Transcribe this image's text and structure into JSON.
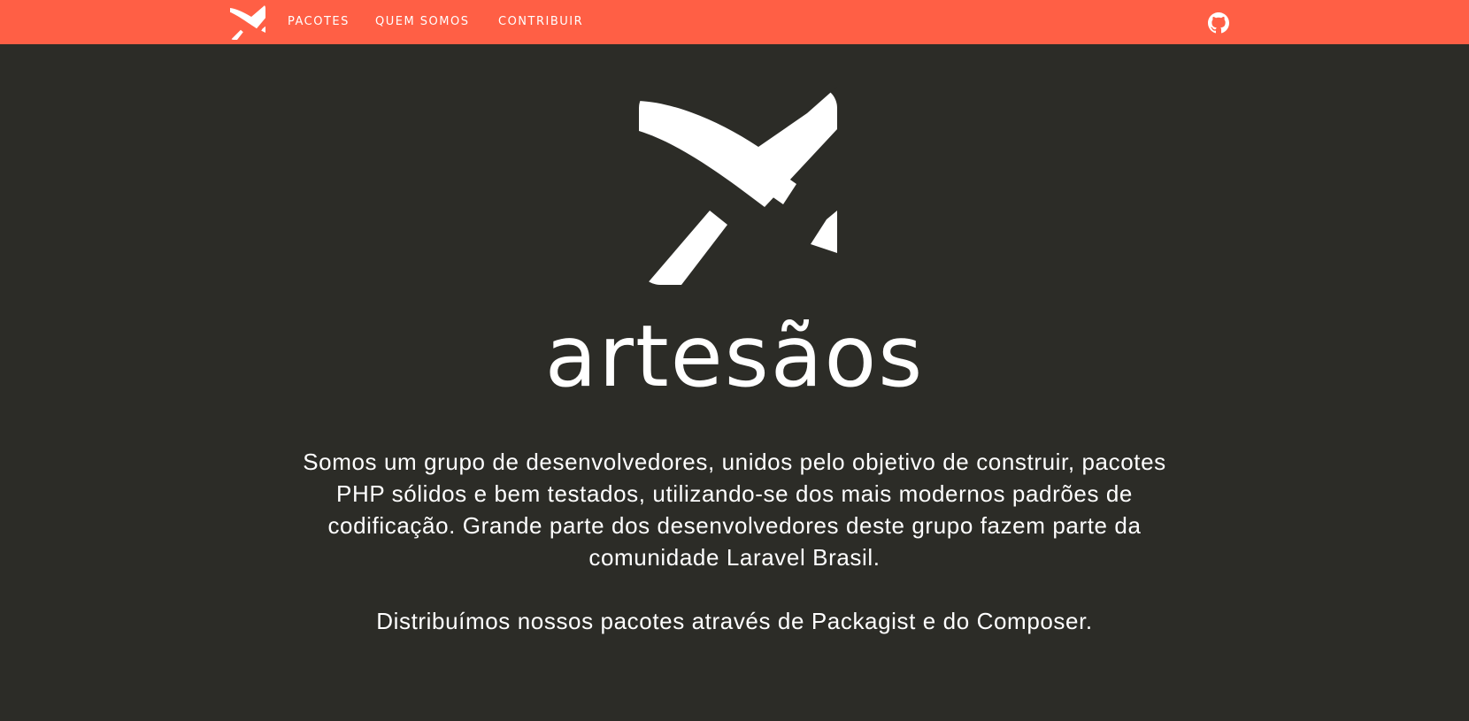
{
  "colors": {
    "navbar_background": "#ff5f45",
    "page_background": "#2c2c27",
    "text": "#ffffff"
  },
  "navbar": {
    "logo_icon": "artesaos-hammer-logo-icon",
    "links": [
      "PACOTES",
      "QUEM SOMOS",
      "CONTRIBUIR"
    ],
    "github_icon": "github-icon"
  },
  "hero": {
    "logo_icon": "artesaos-hammer-logo-icon",
    "brand_name": "artesãos"
  },
  "content": {
    "about": "Somos um grupo de desenvolvedores, unidos pelo objetivo de construir, pacotes PHP sólidos e bem testados, utilizando-se dos mais modernos padrões de codificação. Grande parte dos desenvolvedores deste grupo fazem parte da comunidade Laravel Brasil.",
    "distribution": "Distribuímos nossos pacotes através de Packagist e do Composer."
  }
}
